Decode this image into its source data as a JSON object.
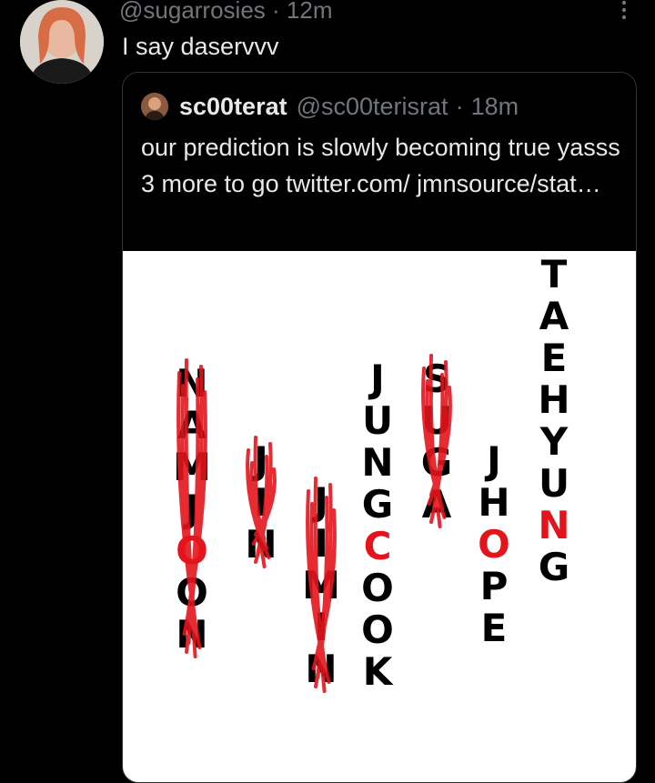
{
  "tweet": {
    "handle": "@sugarrosies",
    "separator": "·",
    "time": "12m",
    "text": "I say daservvv",
    "avatar_icon": "user-avatar"
  },
  "quote": {
    "name": "sc00terat",
    "handle": "@sc00terisrat",
    "separator": "·",
    "time": "18m",
    "text": "our prediction is slowly becoming true yasss 3 more to go twitter.com/ jmnsource/stat…",
    "avatar_icon": "user-avatar"
  },
  "image": {
    "columns": [
      {
        "letters": [
          "N",
          "A",
          "M",
          "J",
          "O",
          "O",
          "N"
        ],
        "highlight": 4
      },
      {
        "letters": [
          "J",
          "I",
          "N"
        ],
        "highlight": null
      },
      {
        "letters": [
          "J",
          "I",
          "M",
          "I",
          "N"
        ],
        "highlight": null
      },
      {
        "letters": [
          "J",
          "U",
          "N",
          "G",
          "C",
          "O",
          "O",
          "K"
        ],
        "highlight": 4
      },
      {
        "letters": [
          "S",
          "U",
          "G",
          "A"
        ],
        "highlight": 4
      },
      {
        "letters": [
          "J",
          "H",
          "O",
          "P",
          "E"
        ],
        "highlight": 2
      },
      {
        "letters": [
          "T",
          "A",
          "E",
          "H",
          "Y",
          "U",
          "N",
          "G"
        ],
        "highlight": 6
      }
    ],
    "highlight_color": "#e4141c",
    "scribble_color": "#e4141c",
    "letter_color": "#000000"
  },
  "colors": {
    "background": "#000000",
    "text": "#e7e9ea",
    "muted": "#71767b",
    "border": "#2f3336"
  }
}
